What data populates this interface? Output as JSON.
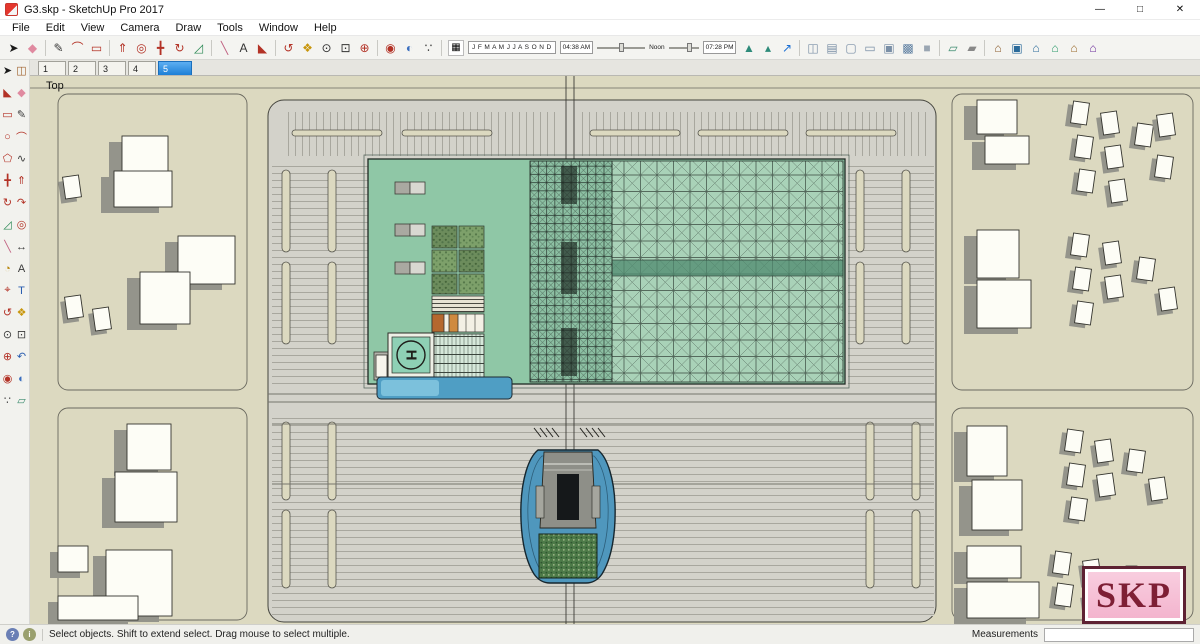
{
  "window": {
    "title": "G3.skp - SketchUp Pro 2017",
    "controls": [
      {
        "name": "minimize-button",
        "glyph": "—"
      },
      {
        "name": "maximize-button",
        "glyph": "□"
      },
      {
        "name": "close-button",
        "glyph": "✕"
      }
    ]
  },
  "menu": {
    "items": [
      {
        "name": "menu-file",
        "label": "File"
      },
      {
        "name": "menu-edit",
        "label": "Edit"
      },
      {
        "name": "menu-view",
        "label": "View"
      },
      {
        "name": "menu-camera",
        "label": "Camera"
      },
      {
        "name": "menu-draw",
        "label": "Draw"
      },
      {
        "name": "menu-tools",
        "label": "Tools"
      },
      {
        "name": "menu-window",
        "label": "Window"
      },
      {
        "name": "menu-help",
        "label": "Help"
      }
    ]
  },
  "toolbar": {
    "items": [
      {
        "name": "select-tool-icon",
        "glyph": "➤",
        "color": "#1a1a1a"
      },
      {
        "name": "eraser-tool-icon",
        "glyph": "◆",
        "color": "#e08aa0"
      },
      {
        "sep": true
      },
      {
        "name": "line-tool-icon",
        "glyph": "✎",
        "color": "#3a3a3a"
      },
      {
        "name": "arc-tool-icon",
        "glyph": "⌒",
        "color": "#b33226"
      },
      {
        "name": "shapes-tool-icon",
        "glyph": "▭",
        "color": "#b33226"
      },
      {
        "sep": true
      },
      {
        "name": "push-pull-tool-icon",
        "glyph": "⇑",
        "color": "#b33226"
      },
      {
        "name": "offset-tool-icon",
        "glyph": "◎",
        "color": "#b33226"
      },
      {
        "name": "move-tool-icon",
        "glyph": "╋",
        "color": "#b33226"
      },
      {
        "name": "rotate-tool-icon",
        "glyph": "↻",
        "color": "#b33226"
      },
      {
        "name": "scale-tool-icon",
        "glyph": "◿",
        "color": "#2e8b57"
      },
      {
        "sep": true
      },
      {
        "name": "tape-measure-icon",
        "glyph": "╲",
        "color": "#c06080"
      },
      {
        "name": "text-tool-icon",
        "glyph": "A",
        "color": "#333333"
      },
      {
        "name": "paint-bucket-icon",
        "glyph": "◣",
        "color": "#b33226"
      },
      {
        "sep": true
      },
      {
        "name": "orbit-tool-icon",
        "glyph": "↺",
        "color": "#b33226"
      },
      {
        "name": "pan-tool-icon",
        "glyph": "❖",
        "color": "#c8960c"
      },
      {
        "name": "zoom-tool-icon",
        "glyph": "⊙",
        "color": "#333333"
      },
      {
        "name": "zoom-window-icon",
        "glyph": "⊡",
        "color": "#333333"
      },
      {
        "name": "zoom-extents-icon",
        "glyph": "⊕",
        "color": "#b33226"
      },
      {
        "sep": true
      },
      {
        "name": "position-camera-icon",
        "glyph": "◉",
        "color": "#b33226"
      },
      {
        "name": "look-around-icon",
        "glyph": "◐",
        "color": "#3a6ebf"
      },
      {
        "name": "walk-tool-icon",
        "glyph": "∵",
        "color": "#333333"
      },
      {
        "sep": true
      }
    ],
    "shadow": {
      "months": "J F M A M J J A S O N D",
      "time_start": "04:38 AM",
      "time_noon": "Noon",
      "time_end": "07:28 PM"
    },
    "items_right": [
      {
        "name": "terrain-icon",
        "glyph": "▲",
        "color": "#2e8b7a"
      },
      {
        "name": "add-detail-icon",
        "glyph": "▴",
        "color": "#2e8b7a"
      },
      {
        "name": "chart-icon",
        "glyph": "↗",
        "color": "#1a6fd4"
      },
      {
        "sep": true
      },
      {
        "name": "xray-style-icon",
        "glyph": "◫",
        "color": "#7a8fa6"
      },
      {
        "name": "back-edges-style-icon",
        "glyph": "▤",
        "color": "#7a8fa6"
      },
      {
        "name": "wireframe-style-icon",
        "glyph": "▢",
        "color": "#7a8fa6"
      },
      {
        "name": "hidden-line-style-icon",
        "glyph": "▭",
        "color": "#7a8fa6"
      },
      {
        "name": "shaded-style-icon",
        "glyph": "▣",
        "color": "#7a8fa6"
      },
      {
        "name": "textured-style-icon",
        "glyph": "▩",
        "color": "#5b7da0"
      },
      {
        "name": "monochrome-style-icon",
        "glyph": "■",
        "color": "#9aa6b2"
      },
      {
        "sep": true
      },
      {
        "name": "section-plane-icon",
        "glyph": "▱",
        "color": "#3a8a6e"
      },
      {
        "name": "section-cuts-icon",
        "glyph": "▰",
        "color": "#888888"
      },
      {
        "sep": true
      },
      {
        "name": "iso-view-icon",
        "glyph": "⌂",
        "color": "#8a5a2a"
      },
      {
        "name": "top-view-icon",
        "glyph": "▣",
        "color": "#2a6a9a"
      },
      {
        "name": "front-view-icon",
        "glyph": "⌂",
        "color": "#2a6a9a"
      },
      {
        "name": "right-view-icon",
        "glyph": "⌂",
        "color": "#2a9a6a"
      },
      {
        "name": "back-view-icon",
        "glyph": "⌂",
        "color": "#9a6a2a"
      },
      {
        "name": "left-view-icon",
        "glyph": "⌂",
        "color": "#6a2a9a"
      }
    ]
  },
  "palette": {
    "tools": [
      {
        "name": "select-tool-icon",
        "glyph": "➤",
        "color": "#1a1a1a"
      },
      {
        "name": "make-component-icon",
        "glyph": "◫",
        "color": "#a0622d"
      },
      {
        "name": "paint-bucket-icon",
        "glyph": "◣",
        "color": "#b33226"
      },
      {
        "name": "eraser-tool-icon",
        "glyph": "◆",
        "color": "#e08aa0"
      },
      {
        "name": "rectangle-tool-icon",
        "glyph": "▭",
        "color": "#b33226"
      },
      {
        "name": "line-tool-icon",
        "glyph": "✎",
        "color": "#3a3a3a"
      },
      {
        "name": "circle-tool-icon",
        "glyph": "○",
        "color": "#b33226"
      },
      {
        "name": "arc-tool-icon",
        "glyph": "⌒",
        "color": "#b33226"
      },
      {
        "name": "polygon-tool-icon",
        "glyph": "⬠",
        "color": "#b33226"
      },
      {
        "name": "freehand-tool-icon",
        "glyph": "∿",
        "color": "#3a3a3a"
      },
      {
        "name": "move-tool-icon",
        "glyph": "╋",
        "color": "#b33226"
      },
      {
        "name": "push-pull-tool-icon",
        "glyph": "⇑",
        "color": "#b33226"
      },
      {
        "name": "rotate-tool-icon",
        "glyph": "↻",
        "color": "#b33226"
      },
      {
        "name": "follow-me-tool-icon",
        "glyph": "↷",
        "color": "#b33226"
      },
      {
        "name": "scale-tool-icon",
        "glyph": "◿",
        "color": "#2e8b57"
      },
      {
        "name": "offset-tool-icon",
        "glyph": "◎",
        "color": "#b33226"
      },
      {
        "name": "tape-measure-icon",
        "glyph": "╲",
        "color": "#c06080"
      },
      {
        "name": "dimension-tool-icon",
        "glyph": "↔",
        "color": "#3a3a3a"
      },
      {
        "name": "protractor-tool-icon",
        "glyph": "◔",
        "color": "#b8860b"
      },
      {
        "name": "text-tool-icon",
        "glyph": "A",
        "color": "#3a3a3a"
      },
      {
        "name": "axes-tool-icon",
        "glyph": "⌖",
        "color": "#b33226"
      },
      {
        "name": "3d-text-tool-icon",
        "glyph": "T",
        "color": "#2a5db0"
      },
      {
        "name": "orbit-tool-icon",
        "glyph": "↺",
        "color": "#b33226"
      },
      {
        "name": "pan-tool-icon",
        "glyph": "❖",
        "color": "#c8960c"
      },
      {
        "name": "zoom-tool-icon",
        "glyph": "⊙",
        "color": "#3a3a3a"
      },
      {
        "name": "zoom-window-icon",
        "glyph": "⊡",
        "color": "#3a3a3a"
      },
      {
        "name": "zoom-extents-icon",
        "glyph": "⊕",
        "color": "#b33226"
      },
      {
        "name": "previous-view-icon",
        "glyph": "↶",
        "color": "#2a5db0"
      },
      {
        "name": "position-camera-icon",
        "glyph": "◉",
        "color": "#b33226"
      },
      {
        "name": "look-around-icon",
        "glyph": "◐",
        "color": "#3a6ebf"
      },
      {
        "name": "walk-tool-icon",
        "glyph": "∵",
        "color": "#3a3a3a"
      },
      {
        "name": "section-plane-icon",
        "glyph": "▱",
        "color": "#3a8a6e"
      }
    ]
  },
  "scenes": {
    "tabs": [
      {
        "name": "scene-tab-1",
        "label": "1"
      },
      {
        "name": "scene-tab-2",
        "label": "2"
      },
      {
        "name": "scene-tab-3",
        "label": "3"
      },
      {
        "name": "scene-tab-4",
        "label": "4"
      },
      {
        "name": "scene-tab-5",
        "label": "5",
        "selected": true
      }
    ]
  },
  "viewport": {
    "view_label": "Top"
  },
  "watermark": {
    "text": "SKP"
  },
  "statusbar": {
    "icons": [
      {
        "name": "help-icon",
        "glyph": "?",
        "bg": "#6a7fb5",
        "color": "#ffffff"
      },
      {
        "name": "account-icon",
        "glyph": "i",
        "bg": "#9aa06e",
        "color": "#ffffff"
      }
    ],
    "message": "Select objects. Shift to extend select. Drag mouse to select multiple.",
    "measurements_label": "Measurements"
  },
  "colors": {
    "accent_tab_blue": "#1d7fd6",
    "canvas_beige": "#dcd9c0",
    "parking_gray": "#d3d2ca",
    "building_green": "#8fc7a6",
    "pool_blue": "#4f97bd",
    "logo_pink": "#f3b3cd"
  }
}
